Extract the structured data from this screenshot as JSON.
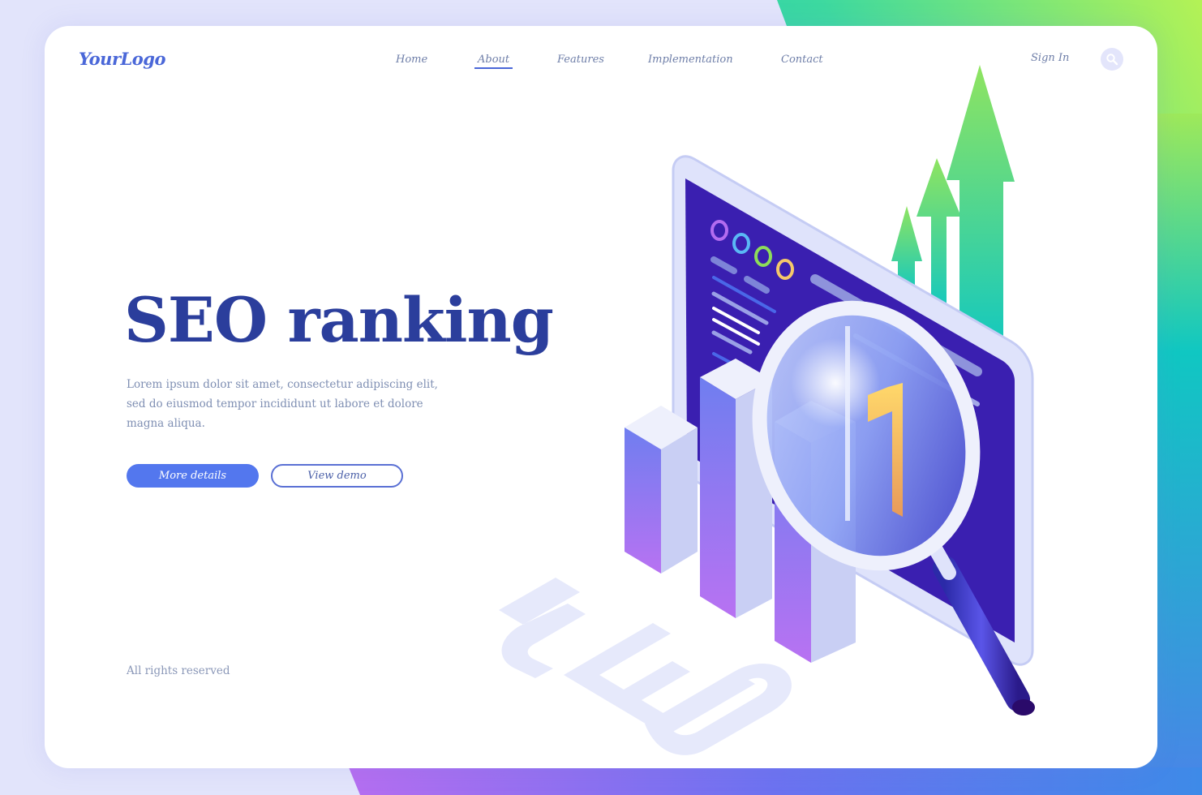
{
  "header": {
    "logo": "YourLogo",
    "nav": [
      {
        "label": "Home",
        "active": false
      },
      {
        "label": "About",
        "active": true
      },
      {
        "label": "Features",
        "active": false
      },
      {
        "label": "Implementation",
        "active": false
      },
      {
        "label": "Contact",
        "active": false
      }
    ],
    "sign_in": "Sign In",
    "search_icon": "search-icon"
  },
  "hero": {
    "title": "SEO ranking",
    "description": "Lorem ipsum dolor sit amet, consectetur adipiscing elit, sed do eiusmod tempor incididunt ut labore et dolore magna aliqua.",
    "primary_button": "More details",
    "secondary_button": "View demo"
  },
  "illustration": {
    "rank_number": "1",
    "floor_text": "SEO",
    "dot_colors": [
      "#b36cf0",
      "#5ab8f5",
      "#8ddc5a",
      "#f5c86a"
    ],
    "arrow_count": 3,
    "bar_count": 3
  },
  "footer": {
    "text": "All rights reserved"
  },
  "colors": {
    "accent": "#5377ee",
    "title": "#2b3e9c",
    "screen": "#3a1fb0"
  }
}
